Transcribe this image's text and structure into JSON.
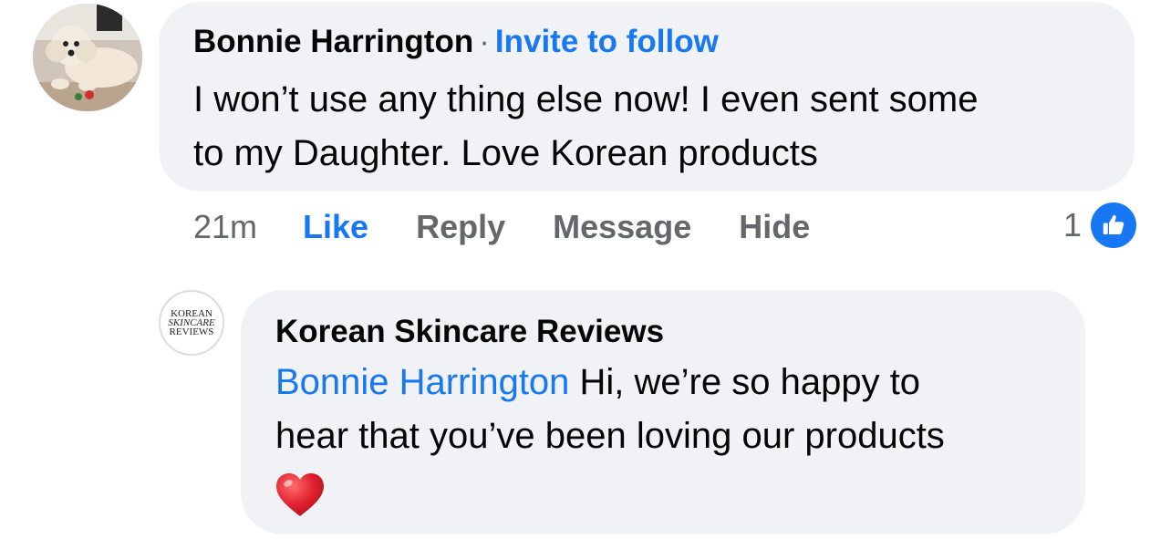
{
  "comment": {
    "author": "Bonnie Harrington",
    "separator": "·",
    "invite_label": "Invite to follow",
    "text_line1": "I won’t use any thing else now!  I even sent some",
    "text_line2": "to my Daughter. Love Korean products",
    "time": "21m",
    "actions": {
      "like": "Like",
      "reply": "Reply",
      "message": "Message",
      "hide": "Hide"
    },
    "reaction_count": "1",
    "reaction_icon": "like-thumb-icon"
  },
  "reply": {
    "author": "Korean Skincare Reviews",
    "avatar_logo": [
      "KOREAN",
      "SKINCARE",
      "REVIEWS"
    ],
    "mention": "Bonnie Harrington",
    "text_line1": " Hi, we’re so happy to",
    "text_line2": "hear that you’ve been loving our products",
    "emoji": "red-heart-icon"
  },
  "colors": {
    "link_blue": "#1877f2",
    "bubble_bg": "#f0f2f5",
    "meta_gray": "#65676b",
    "heart_red": "#e0202e"
  }
}
